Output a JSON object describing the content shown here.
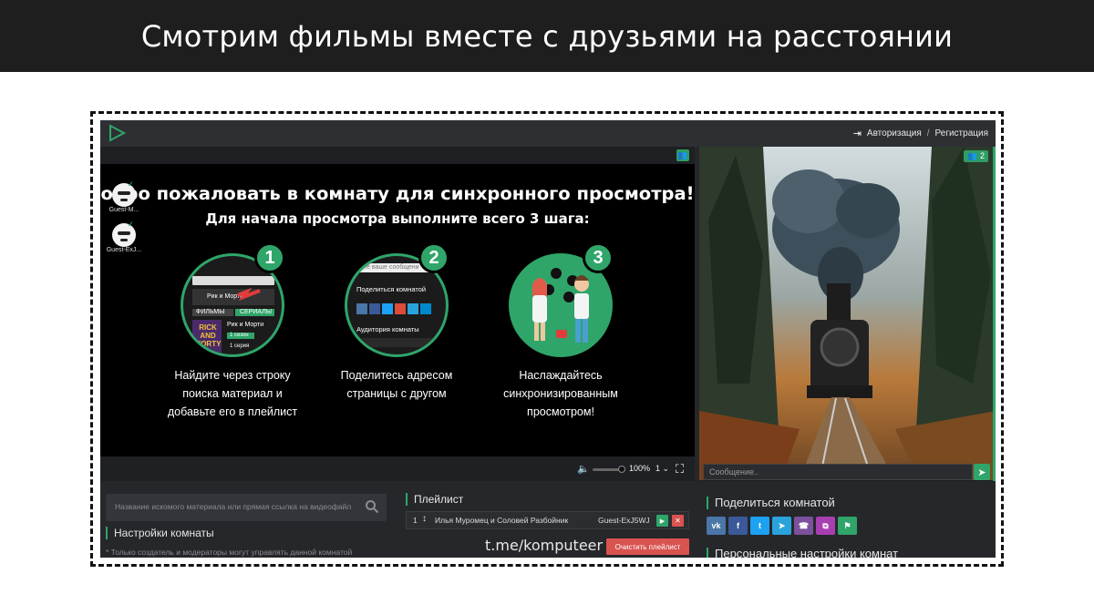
{
  "banner": {
    "title": "Смотрим фильмы вместе с друзьями на расстоянии"
  },
  "header": {
    "login_label": "Авторизация",
    "separator": "/",
    "register_label": "Регистрация"
  },
  "player": {
    "welcome_title": "обро пожаловать в комнату для синхронного просмотра!",
    "welcome_subtitle": "Для начала просмотра выполните всего 3 шага:",
    "guests": [
      {
        "name": "Guest-M..."
      },
      {
        "name": "Guest-ExJ..."
      }
    ],
    "steps": [
      {
        "number": "1",
        "text_lines": [
          "Найдите через строку",
          "поиска материал и",
          "добавьте его в плейлист"
        ],
        "mini": {
          "tab_films": "ФИЛЬМЫ",
          "tab_series": "СЕРИАЛЫ",
          "item_title": "Рик и Морти",
          "poster_title": "RICK AND MORTY",
          "sub_item": "Рик и Морти",
          "season_badge": "1 сезон",
          "episode": "1 серия"
        }
      },
      {
        "number": "2",
        "text_lines": [
          "Поделитесь адресом",
          "страницы с другом"
        ],
        "mini": {
          "placeholder": "ите ваше сообщени",
          "share_label": "Поделиться комнатой",
          "audience_label": "Аудитория комнаты"
        }
      },
      {
        "number": "3",
        "text_lines": [
          "Наслаждайтесь",
          "синхронизированным",
          "просмотром!"
        ]
      }
    ],
    "controls": {
      "zoom": "100%",
      "speed": "1"
    }
  },
  "side_video": {
    "users_count": "2"
  },
  "chat": {
    "placeholder": "Сообщение.."
  },
  "search": {
    "placeholder": "Название искомого материала или прямая ссылка на видеофайл"
  },
  "room_settings": {
    "title": "Настройки комнаты",
    "note": "* Только создатель и модераторы могут управлять данной комнатой"
  },
  "playlist": {
    "title": "Плейлист",
    "items": [
      {
        "index": "1",
        "name": "Илья Муромец и Соловей Разбойник",
        "added_by": "Guest-ExJ5WJ"
      }
    ],
    "clear_label": "Очистить плейлист"
  },
  "watermark": "t.me/komputeer",
  "share": {
    "title": "Поделиться комнатой",
    "buttons": [
      {
        "icon": "vk-icon",
        "glyph": "vk",
        "color": "#4a76a8"
      },
      {
        "icon": "facebook-icon",
        "glyph": "f",
        "color": "#3b5998"
      },
      {
        "icon": "twitter-icon",
        "glyph": "t",
        "color": "#1da1f2"
      },
      {
        "icon": "telegram-icon",
        "glyph": "➤",
        "color": "#2aa3dc"
      },
      {
        "icon": "viber-icon",
        "glyph": "☎",
        "color": "#7b519d"
      },
      {
        "icon": "copy-icon",
        "glyph": "⧉",
        "color": "#a83fb0"
      },
      {
        "icon": "bookmark-icon",
        "glyph": "⚑",
        "color": "#2fa56a"
      }
    ]
  },
  "personal_settings": {
    "title": "Персональные настройки комнат"
  },
  "colors": {
    "accent": "#2fa56a",
    "danger": "#d9534f",
    "panel": "#26272b"
  }
}
